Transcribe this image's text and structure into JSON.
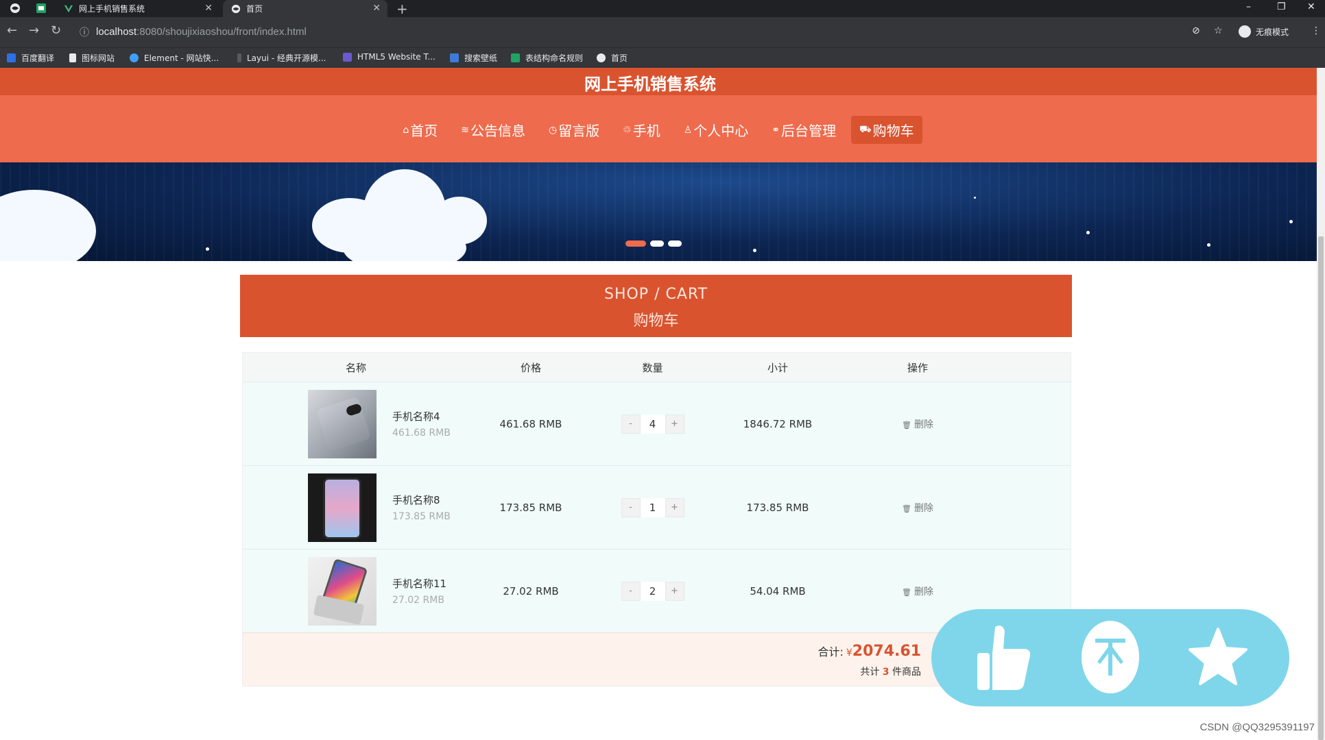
{
  "browser": {
    "tabs": [
      {
        "title": "网上手机销售系统",
        "active": false
      },
      {
        "title": "首页",
        "active": true
      }
    ],
    "url_host": "localhost",
    "url_path": ":8080/shoujixiaoshou/front/index.html",
    "profile_label": "无痕模式",
    "bookmarks": [
      "百度翻译",
      "图标网站",
      "Element - 网站快...",
      "Layui - 经典开源模...",
      "HTML5 Website T...",
      "搜索壁纸",
      "表结构命名规则",
      "首页"
    ]
  },
  "site": {
    "title": "网上手机销售系统",
    "nav": [
      {
        "icon": "home-icon",
        "glyph": "⌂",
        "label": "首页"
      },
      {
        "icon": "list-icon",
        "glyph": "≋",
        "label": "公告信息"
      },
      {
        "icon": "clock-icon",
        "glyph": "◷",
        "label": "留言版"
      },
      {
        "icon": "phone-icon",
        "glyph": "♲",
        "label": "手机"
      },
      {
        "icon": "user-icon",
        "glyph": "♙",
        "label": "个人中心"
      },
      {
        "icon": "link-icon",
        "glyph": "⚭",
        "label": "后台管理"
      },
      {
        "icon": "cart-icon",
        "glyph": "⛟",
        "label": "购物车",
        "active": true
      }
    ],
    "accent": "#d9532f"
  },
  "banner": {
    "slides": 3,
    "active_slide": 1
  },
  "cart": {
    "heading_en": "SHOP / CART",
    "heading_cn": "购物车",
    "columns": [
      "名称",
      "价格",
      "数量",
      "小计",
      "操作"
    ],
    "items": [
      {
        "name": "手机名称4",
        "unit_price_sub": "461.68 RMB",
        "price": "461.68 RMB",
        "qty": "4",
        "subtotal": "1846.72 RMB",
        "action": "删除",
        "minus": "-",
        "plus": "+"
      },
      {
        "name": "手机名称8",
        "unit_price_sub": "173.85 RMB",
        "price": "173.85 RMB",
        "qty": "1",
        "subtotal": "173.85 RMB",
        "action": "删除",
        "minus": "-",
        "plus": "+"
      },
      {
        "name": "手机名称11",
        "unit_price_sub": "27.02 RMB",
        "price": "27.02 RMB",
        "qty": "2",
        "subtotal": "54.04 RMB",
        "action": "删除",
        "minus": "-",
        "plus": "+"
      }
    ],
    "total_label": "合计:",
    "currency": "¥",
    "total": "2074.61",
    "count_prefix": "共计",
    "count": "3",
    "count_suffix": "件商品"
  },
  "watermark": "CSDN @QQ3295391197"
}
